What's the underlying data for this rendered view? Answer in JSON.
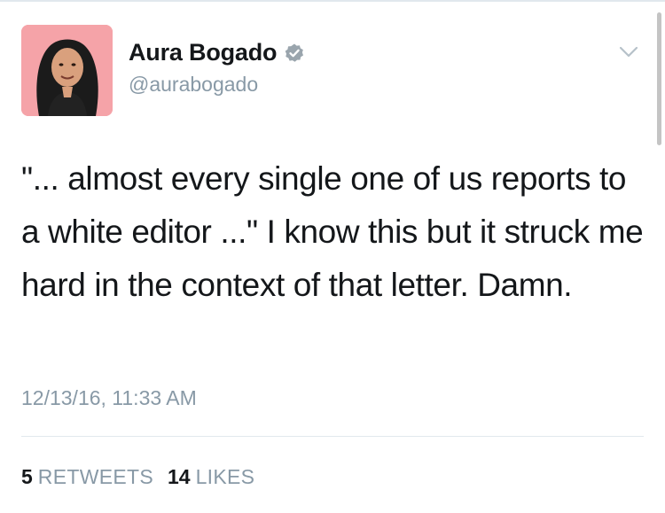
{
  "tweet": {
    "author": {
      "display_name": "Aura Bogado",
      "handle": "@aurabogado",
      "verified": true,
      "avatar": "avatar-photo"
    },
    "text": "\"... almost every single one of us reports to a white editor ...\" I know this but it struck me hard in the context of that letter. Damn.",
    "timestamp": "12/13/16, 11:33 AM",
    "stats": {
      "retweets_count": "5",
      "retweets_label": "RETWEETS",
      "likes_count": "14",
      "likes_label": "LIKES"
    }
  },
  "icons": {
    "verified": "verified-badge-icon",
    "menu": "chevron-down-icon"
  },
  "colors": {
    "text_primary": "#14171a",
    "text_secondary": "#8899a6",
    "divider": "#e1e8ed",
    "avatar_background": "#f5a3a8",
    "verified_badge": "#9aa5ad"
  }
}
